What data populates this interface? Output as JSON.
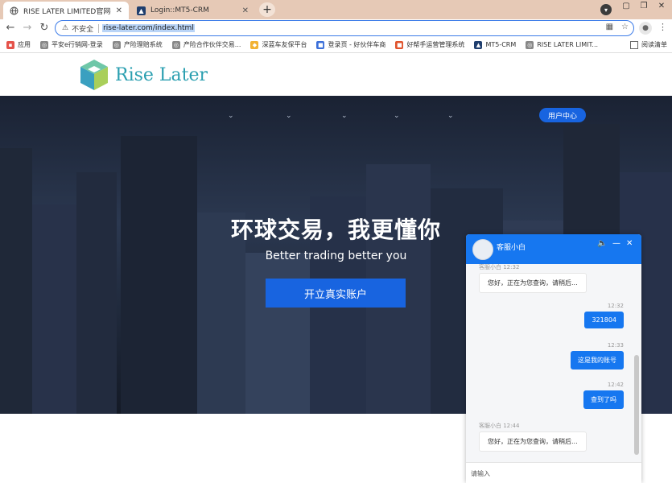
{
  "browser": {
    "tabs": [
      {
        "title": "RISE LATER LIMITED官网-网上",
        "active": true
      },
      {
        "title": "Login::MT5-CRM",
        "active": false
      }
    ],
    "address": {
      "security_label": "不安全",
      "url": "rise-later.com/index.html"
    },
    "bookmarks": [
      {
        "label": "应用",
        "color": "#e5534b"
      },
      {
        "label": "平安e行销网-登录",
        "color": "#888888"
      },
      {
        "label": "产险理赔系统",
        "color": "#888888"
      },
      {
        "label": "产险合作伙伴交易...",
        "color": "#888888"
      },
      {
        "label": "深蓝车友保平台",
        "color": "#f2b233"
      },
      {
        "label": "登录页 - 好伙伴车商",
        "color": "#3b6fd9"
      },
      {
        "label": "好帮手运营管理系统",
        "color": "#e0542d"
      },
      {
        "label": "MT5-CRM",
        "color": "#1f3e6e"
      },
      {
        "label": "RISE LATER LIMIT...",
        "color": "#888888"
      }
    ],
    "reading_list": "阅读清单"
  },
  "site": {
    "logo_text": "Rise Later",
    "user_center": "用户中心",
    "hero_title": "环球交易，我更懂你",
    "hero_subtitle": "Better trading better you",
    "cta_label": "开立真实账户"
  },
  "chat": {
    "agent_name": "客服小白",
    "messages": [
      {
        "from": "agent",
        "meta": "客服小白 12:32",
        "text": "您好，正在为您查询，请稍后..."
      },
      {
        "from": "user",
        "meta": "12:32",
        "text": "321804"
      },
      {
        "from": "user",
        "meta": "12:33",
        "text": "这是我的账号"
      },
      {
        "from": "user",
        "meta": "12:42",
        "text": "查到了吗"
      },
      {
        "from": "agent",
        "meta": "客服小白 12:44",
        "text": "您好，正在为您查询，请稍后..."
      }
    ],
    "input_placeholder": "请输入"
  },
  "colors": {
    "accent": "#1677f0",
    "cta": "#1864e0",
    "logo_teal": "#2a9fb0"
  }
}
